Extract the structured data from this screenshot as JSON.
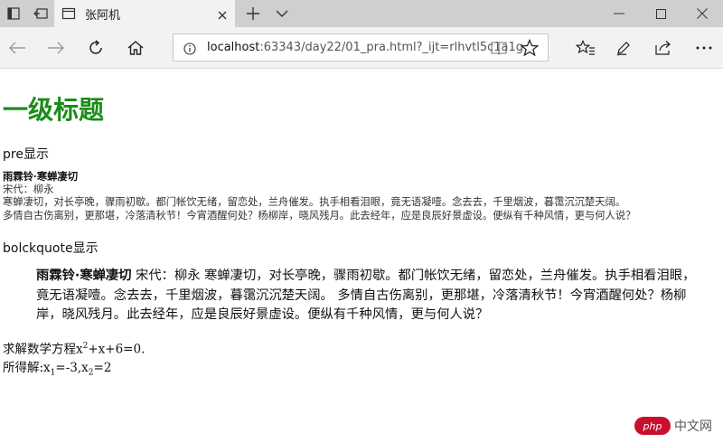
{
  "tab": {
    "title": "张阿机"
  },
  "address": {
    "host": "localhost",
    "path": ":63343/day22/01_pra.html?_ijt=rlhvtl5c1a1g"
  },
  "page": {
    "heading": "一级标题",
    "pre_label": "pre显示",
    "pre": {
      "title": "雨霖铃·寒蝉凄切",
      "author": "宋代：柳永",
      "line1": "寒蝉凄切，对长亭晚，骤雨初歇。都门帐饮无绪，留恋处，兰舟催发。执手相看泪眼，竟无语凝噎。念去去，千里烟波，暮霭沉沉楚天阔。",
      "line2": "多情自古伤离别，更那堪，冷落清秋节！今宵酒醒何处？杨柳岸，晓风残月。此去经年，应是良辰好景虚设。便纵有千种风情，更与何人说？"
    },
    "bq_label": "bolckquote显示",
    "blockquote": {
      "title": "雨霖铃·寒蝉凄切",
      "body": " 宋代：柳永 寒蝉凄切，对长亭晚，骤雨初歇。都门帐饮无绪，留恋处，兰舟催发。执手相看泪眼，竟无语凝噎。念去去，千里烟波，暮霭沉沉楚天阔。 多情自古伤离别，更那堪，冷落清秋节！今宵酒醒何处？杨柳岸，晓风残月。此去经年，应是良辰好景虚设。便纵有千种风情，更与何人说？"
    },
    "math": {
      "eq_prefix": "求解数学方程x",
      "eq_sup": "2",
      "eq_suffix": "+x+6=0.",
      "sol_prefix": "所得解:x",
      "sol_sub1": "1",
      "sol_mid": "=-3,x",
      "sol_sub2": "2",
      "sol_suffix": "=2"
    }
  },
  "watermark": {
    "badge": "php",
    "text": "中文网"
  },
  "colors": {
    "heading": "#1a8c1a",
    "tabstrip": "#cfcfcf",
    "toolbar": "#f2f2f2"
  }
}
